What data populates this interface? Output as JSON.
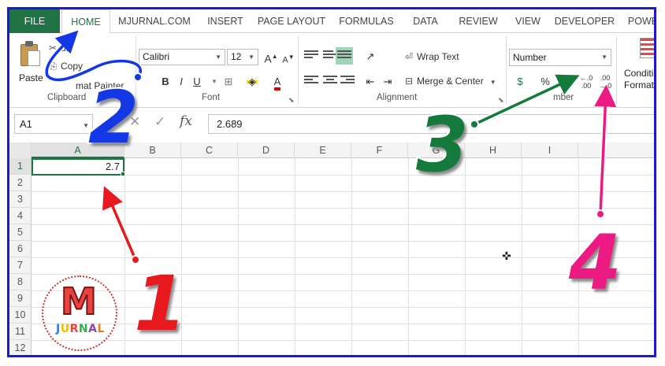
{
  "tabs": [
    "FILE",
    "HOME",
    "MJURNAL.COM",
    "INSERT",
    "PAGE LAYOUT",
    "FORMULAS",
    "DATA",
    "REVIEW",
    "VIEW",
    "DEVELOPER",
    "POWE"
  ],
  "clipboard": {
    "paste_label": "Paste",
    "cut_label": "ut",
    "copy_label": "Copy",
    "painter_label": "mat Painter",
    "group_label": "Clipboard"
  },
  "font": {
    "name": "Calibri",
    "size": "12",
    "grow": "A",
    "shrink": "A",
    "bold": "B",
    "italic": "I",
    "underline": "U",
    "font_color_letter": "A",
    "group_label": "Font"
  },
  "alignment": {
    "wrap_text": "Wrap Text",
    "merge_center": "Merge & Center",
    "group_label": "Alignment"
  },
  "number": {
    "format": "Number",
    "percent": "%",
    "comma": ",",
    "group_label": "mber"
  },
  "styles": {
    "conditional_line1": "Conditi",
    "conditional_line2": "Formatt"
  },
  "formula_bar": {
    "name_box": "A1",
    "fx": "fx",
    "formula": "2.689"
  },
  "grid": {
    "columns": [
      "A",
      "B",
      "C",
      "D",
      "E",
      "F",
      "G",
      "H",
      "I"
    ],
    "rows": [
      "1",
      "2",
      "3",
      "4",
      "5",
      "6",
      "7",
      "8",
      "9",
      "10",
      "11",
      "12"
    ],
    "a1_value": "2.7"
  },
  "annotations": {
    "n1": "1",
    "n2": "2",
    "n3": "3",
    "n4": "4",
    "color1": "#e8191e",
    "color2": "#1438e6",
    "color3": "#147a3c",
    "color4": "#ec1a82"
  },
  "logo": {
    "letter": "M",
    "word": "JURNAL"
  },
  "colors": {
    "excel_green": "#217346",
    "frame_blue": "#1a1ad6"
  }
}
